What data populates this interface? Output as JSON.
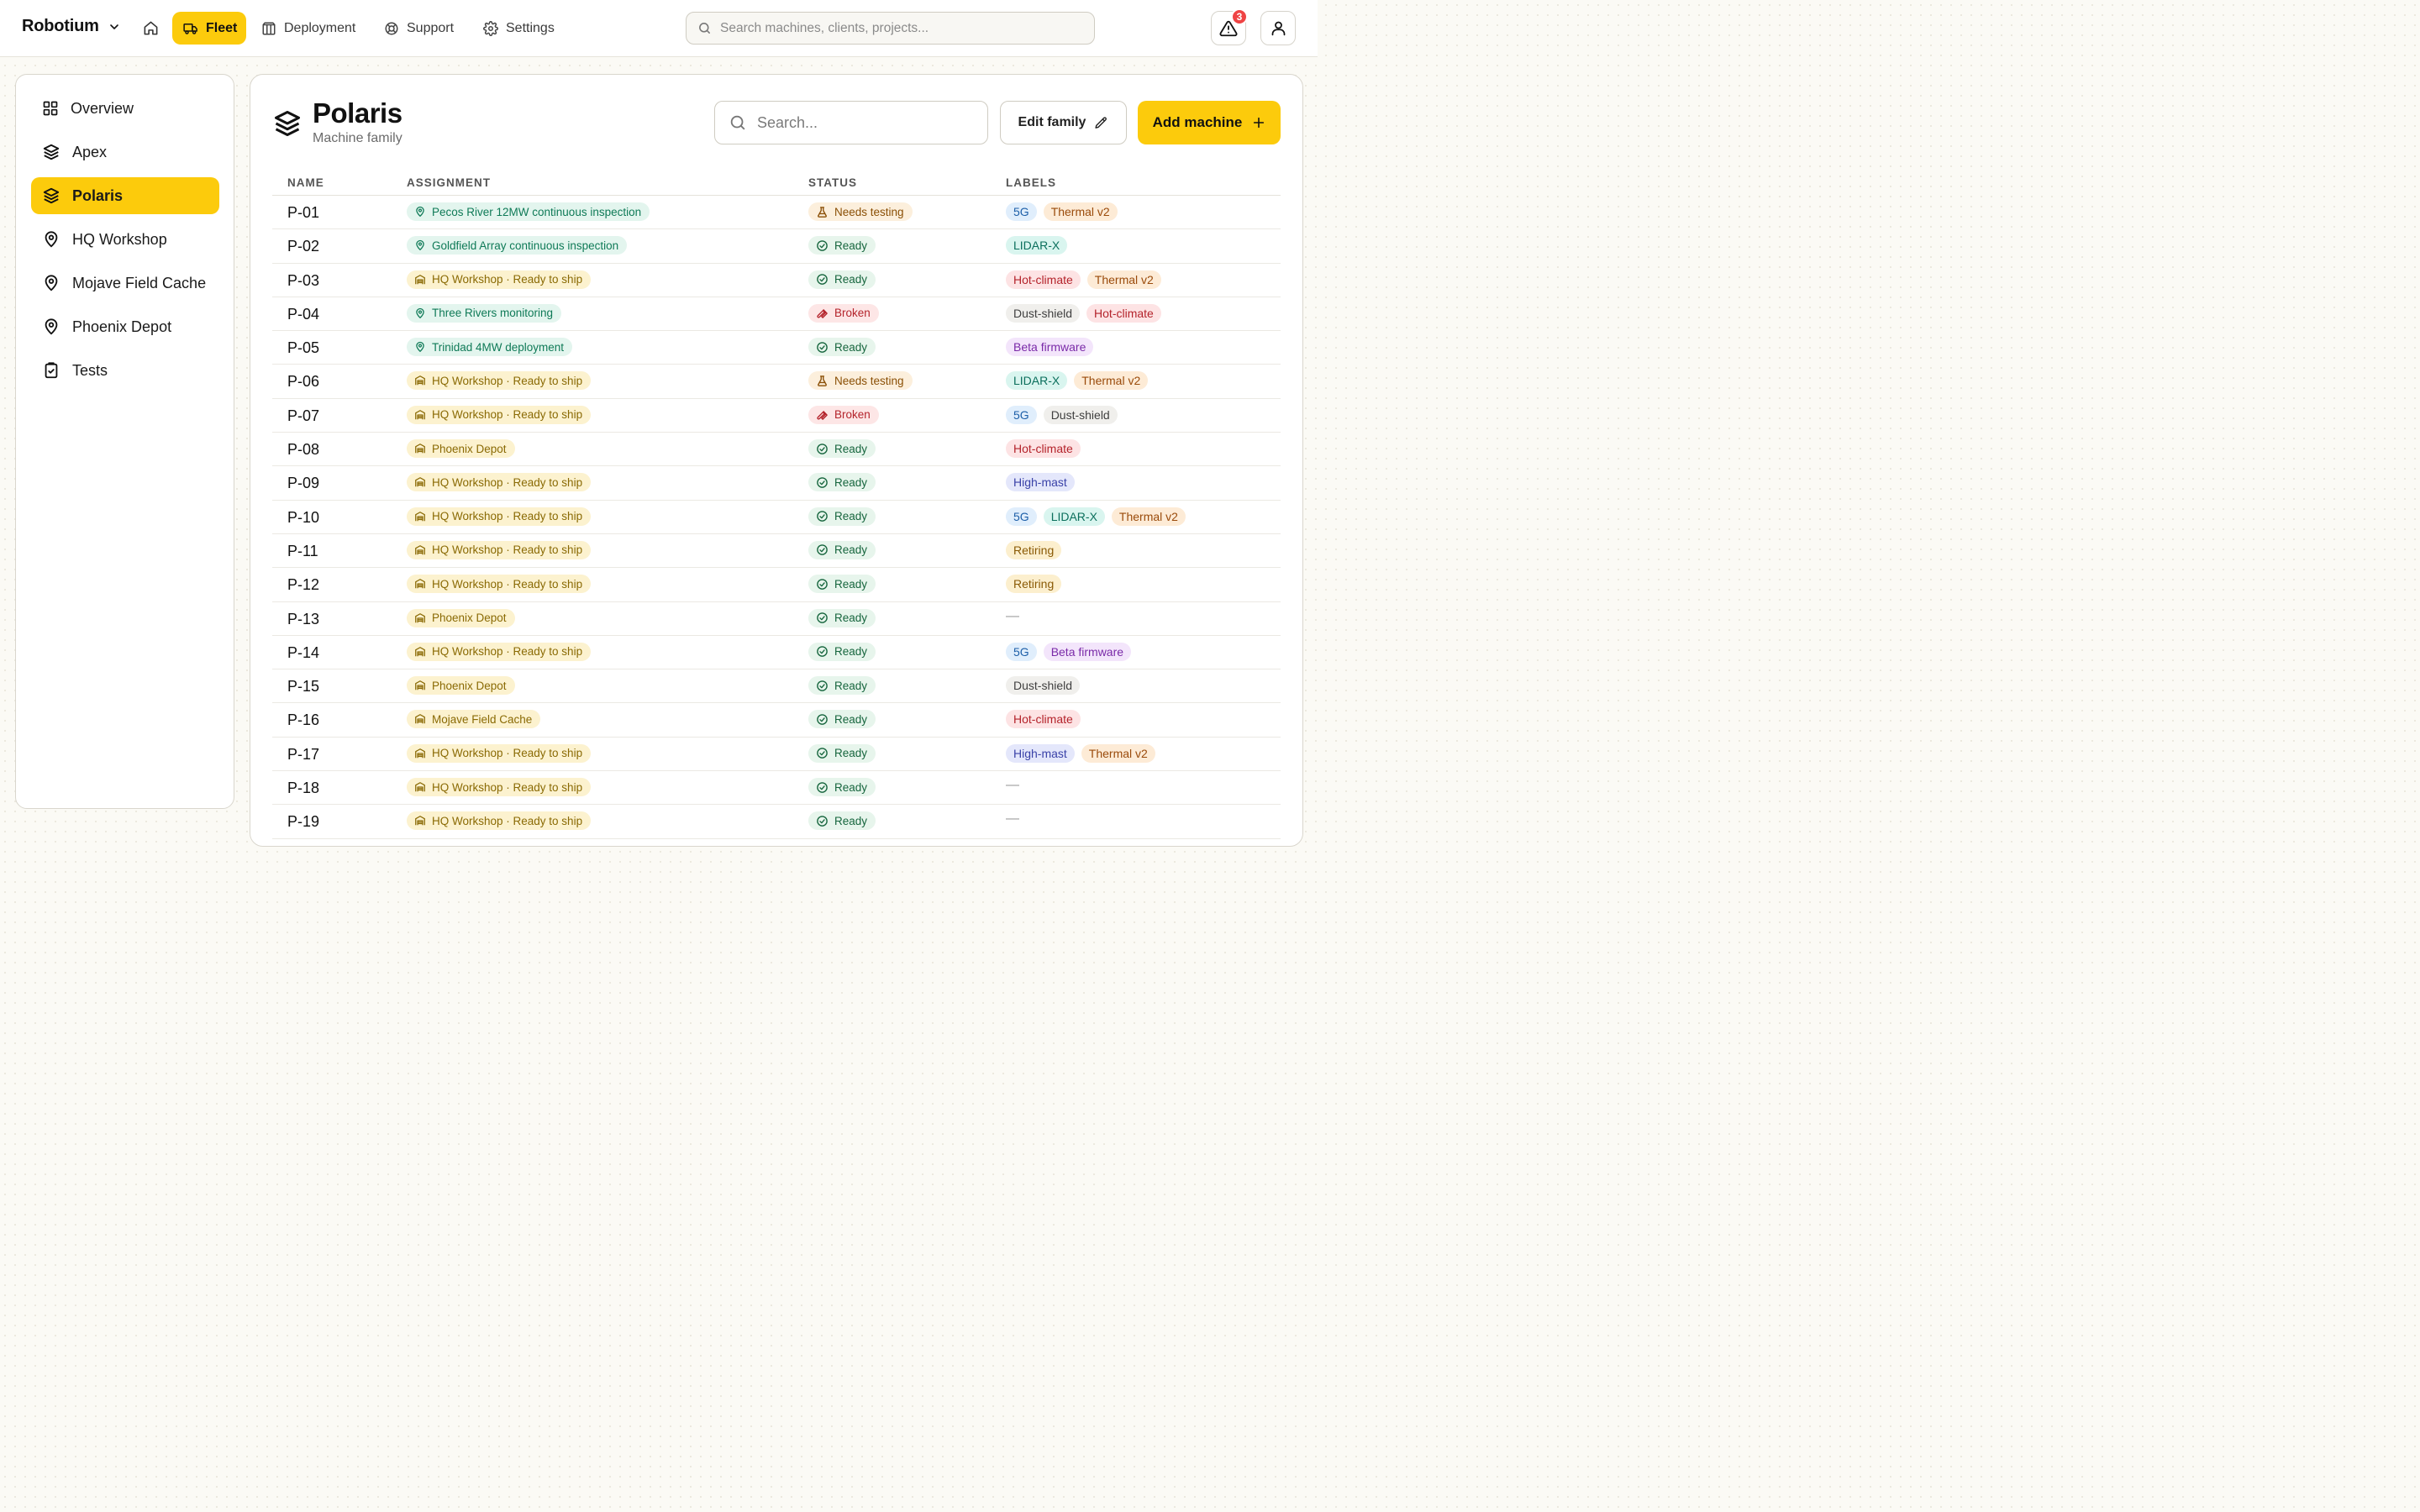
{
  "topbar": {
    "brand": "Robotium",
    "nav": [
      {
        "label": "Fleet",
        "icon": "truck-icon",
        "active": true
      },
      {
        "label": "Deployment",
        "icon": "package-icon",
        "active": false
      },
      {
        "label": "Support",
        "icon": "lifebuoy-icon",
        "active": false
      },
      {
        "label": "Settings",
        "icon": "gear-icon",
        "active": false
      }
    ],
    "search_placeholder": "Search machines, clients, projects...",
    "notification_count": "3"
  },
  "sidebar": {
    "items": [
      {
        "label": "Overview",
        "icon": "grid-icon",
        "active": false
      },
      {
        "label": "Apex",
        "icon": "layers-icon",
        "active": false
      },
      {
        "label": "Polaris",
        "icon": "layers-icon",
        "active": true
      },
      {
        "label": "HQ Workshop",
        "icon": "map-pin-icon",
        "active": false
      },
      {
        "label": "Mojave Field Cache",
        "icon": "map-pin-icon",
        "active": false
      },
      {
        "label": "Phoenix Depot",
        "icon": "map-pin-icon",
        "active": false
      },
      {
        "label": "Tests",
        "icon": "clipboard-check-icon",
        "active": false
      }
    ]
  },
  "family": {
    "title": "Polaris",
    "subtitle": "Machine family",
    "search_placeholder": "Search...",
    "edit_label": "Edit family",
    "add_label": "Add machine"
  },
  "table": {
    "columns": [
      "NAME",
      "ASSIGNMENT",
      "STATUS",
      "LABELS"
    ],
    "rows": [
      {
        "name": "P-01",
        "assignment": "Pecos River 12MW continuous inspection",
        "assign_type": "site",
        "status": "Needs testing",
        "labels": [
          "5G",
          "Thermal v2"
        ]
      },
      {
        "name": "P-02",
        "assignment": "Goldfield Array continuous inspection",
        "assign_type": "site",
        "status": "Ready",
        "labels": [
          "LIDAR-X"
        ]
      },
      {
        "name": "P-03",
        "assignment": "HQ Workshop · Ready to ship",
        "assign_type": "warehouse",
        "status": "Ready",
        "labels": [
          "Hot-climate",
          "Thermal v2"
        ]
      },
      {
        "name": "P-04",
        "assignment": "Three Rivers monitoring",
        "assign_type": "site",
        "status": "Broken",
        "labels": [
          "Dust-shield",
          "Hot-climate"
        ]
      },
      {
        "name": "P-05",
        "assignment": "Trinidad 4MW deployment",
        "assign_type": "site",
        "status": "Ready",
        "labels": [
          "Beta firmware"
        ]
      },
      {
        "name": "P-06",
        "assignment": "HQ Workshop · Ready to ship",
        "assign_type": "warehouse",
        "status": "Needs testing",
        "labels": [
          "LIDAR-X",
          "Thermal v2"
        ]
      },
      {
        "name": "P-07",
        "assignment": "HQ Workshop · Ready to ship",
        "assign_type": "warehouse",
        "status": "Broken",
        "labels": [
          "5G",
          "Dust-shield"
        ]
      },
      {
        "name": "P-08",
        "assignment": "Phoenix Depot",
        "assign_type": "warehouse",
        "status": "Ready",
        "labels": [
          "Hot-climate"
        ]
      },
      {
        "name": "P-09",
        "assignment": "HQ Workshop · Ready to ship",
        "assign_type": "warehouse",
        "status": "Ready",
        "labels": [
          "High-mast"
        ]
      },
      {
        "name": "P-10",
        "assignment": "HQ Workshop · Ready to ship",
        "assign_type": "warehouse",
        "status": "Ready",
        "labels": [
          "5G",
          "LIDAR-X",
          "Thermal v2"
        ]
      },
      {
        "name": "P-11",
        "assignment": "HQ Workshop · Ready to ship",
        "assign_type": "warehouse",
        "status": "Ready",
        "labels": [
          "Retiring"
        ]
      },
      {
        "name": "P-12",
        "assignment": "HQ Workshop · Ready to ship",
        "assign_type": "warehouse",
        "status": "Ready",
        "labels": [
          "Retiring"
        ]
      },
      {
        "name": "P-13",
        "assignment": "Phoenix Depot",
        "assign_type": "warehouse",
        "status": "Ready",
        "labels": []
      },
      {
        "name": "P-14",
        "assignment": "HQ Workshop · Ready to ship",
        "assign_type": "warehouse",
        "status": "Ready",
        "labels": [
          "5G",
          "Beta firmware"
        ]
      },
      {
        "name": "P-15",
        "assignment": "Phoenix Depot",
        "assign_type": "warehouse",
        "status": "Ready",
        "labels": [
          "Dust-shield"
        ]
      },
      {
        "name": "P-16",
        "assignment": "Mojave Field Cache",
        "assign_type": "warehouse",
        "status": "Ready",
        "labels": [
          "Hot-climate"
        ]
      },
      {
        "name": "P-17",
        "assignment": "HQ Workshop · Ready to ship",
        "assign_type": "warehouse",
        "status": "Ready",
        "labels": [
          "High-mast",
          "Thermal v2"
        ]
      },
      {
        "name": "P-18",
        "assignment": "HQ Workshop · Ready to ship",
        "assign_type": "warehouse",
        "status": "Ready",
        "labels": []
      },
      {
        "name": "P-19",
        "assignment": "HQ Workshop · Ready to ship",
        "assign_type": "warehouse",
        "status": "Ready",
        "labels": []
      }
    ],
    "empty_label": "—"
  },
  "label_colors": {
    "5G": {
      "bg": "#e0eefc",
      "fg": "#1d5fa8"
    },
    "Thermal v2": {
      "bg": "#fdebd6",
      "fg": "#9a4b0b"
    },
    "LIDAR-X": {
      "bg": "#d9f5ef",
      "fg": "#0b6f5c"
    },
    "Hot-climate": {
      "bg": "#fde3e4",
      "fg": "#b4232b"
    },
    "Dust-shield": {
      "bg": "#f0efec",
      "fg": "#3f3f3f"
    },
    "Beta firmware": {
      "bg": "#f3e5fb",
      "fg": "#7a2aa8"
    },
    "High-mast": {
      "bg": "#e4e7fb",
      "fg": "#3a42a8"
    },
    "Retiring": {
      "bg": "#fcefce",
      "fg": "#8a5a05"
    }
  },
  "colors": {
    "accent": "#fccb0c",
    "danger": "#ef4444"
  }
}
